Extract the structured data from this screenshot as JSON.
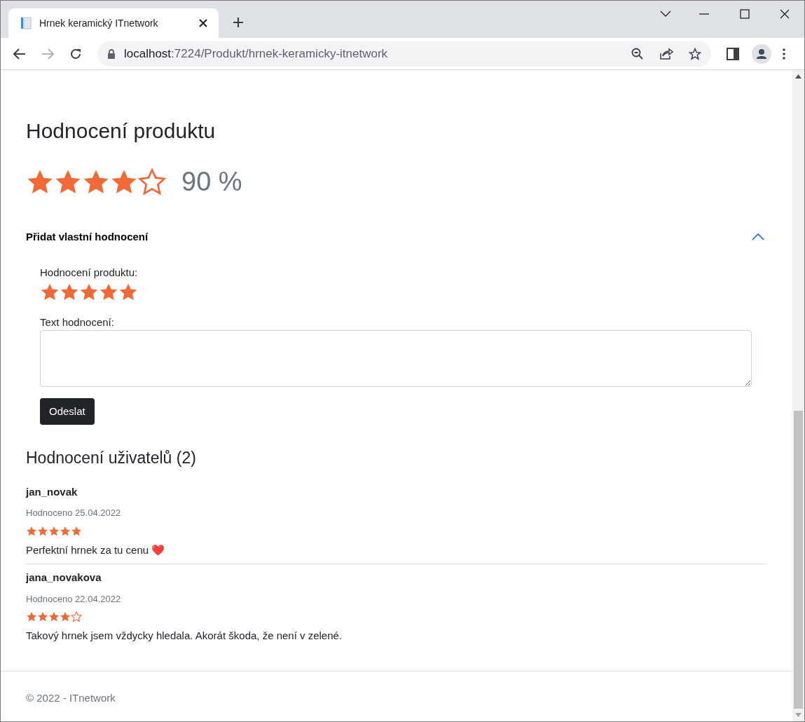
{
  "browser": {
    "tab_title": "Hrnek keramický ITnetwork",
    "url_host": "localhost",
    "url_path": ":7224/Produkt/hrnek-keramicky-itnetwork"
  },
  "rating": {
    "heading": "Hodnocení produktu",
    "stars": 4,
    "percent": "90 %"
  },
  "add_review": {
    "title": "Přidat vlastní hodnocení",
    "expanded": true,
    "rating_label": "Hodnocení produktu:",
    "stars": 5,
    "text_label": "Text hodnocení:",
    "submit": "Odeslat"
  },
  "reviews_heading": "Hodnocení uživatelů (2)",
  "reviews": [
    {
      "user": "jan_novak",
      "date": "Hodnoceno 25.04.2022",
      "stars": 5,
      "text": "Perfektní hrnek za tu cenu ❤️"
    },
    {
      "user": "jana_novakova",
      "date": "Hodnoceno 22.04.2022",
      "stars": 4,
      "text": "Takový hrnek jsem vždycky hledala. Akorát škoda, že není v zelené."
    }
  ],
  "footer": "© 2022 - ITnetwork"
}
